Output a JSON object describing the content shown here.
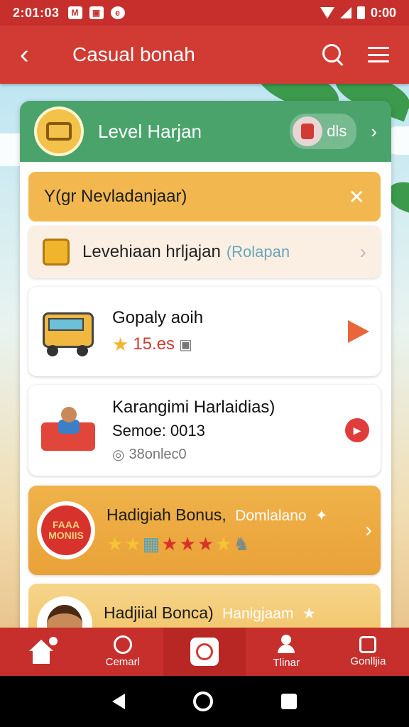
{
  "status_bar": {
    "time": "2:01:03",
    "right_text": "0:00"
  },
  "app_bar": {
    "title": "Casual bonah"
  },
  "header": {
    "title": "Level Harjan",
    "pill_text": "dls"
  },
  "banner": {
    "text": "Y(gr Nevladanjaar)"
  },
  "link_row": {
    "title": "Levehiaan hrljajan",
    "subtitle": "(Rolapan"
  },
  "games": [
    {
      "title": "Gopaly aoih",
      "rating": "15.es"
    },
    {
      "title": "Karangimi Harlaidias)",
      "subtitle": "Semoe: 0013",
      "meta": "38onlec0"
    }
  ],
  "bonus": {
    "badge_line1": "FAAA",
    "badge_line2": "MONIIS",
    "title": "Hadigiah Bonus,",
    "subtitle": "Domlalano"
  },
  "bonus2": {
    "title": "Hadjiial Bonca)",
    "subtitle": "Hanigjaam"
  },
  "bottom_nav": [
    {
      "label": ""
    },
    {
      "label": "Cemarl"
    },
    {
      "label": ""
    },
    {
      "label": "Tlinar"
    },
    {
      "label": "Gonlljia"
    }
  ],
  "colors": {
    "primary": "#d23a34",
    "header_green": "#4aa36b",
    "banner_yellow": "#f2b84f",
    "accent_orange": "#e8663a"
  }
}
